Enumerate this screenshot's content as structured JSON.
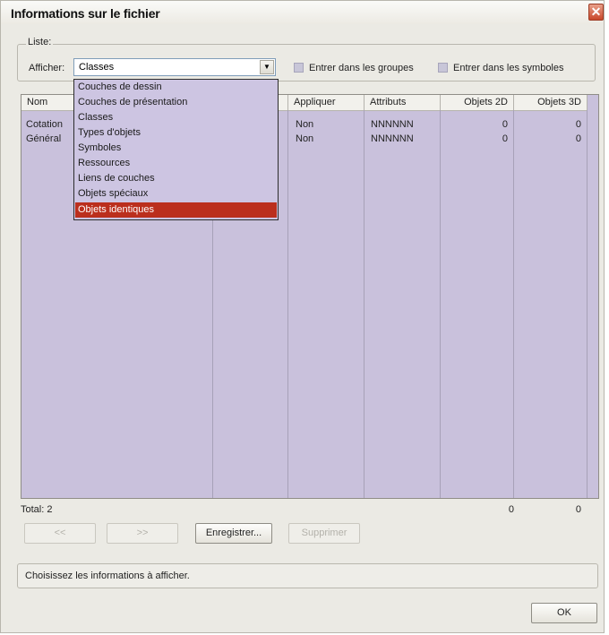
{
  "window": {
    "title": "Informations sur le fichier",
    "close_glyph": "✕"
  },
  "liste": {
    "group_label": "Liste:",
    "afficher_label": "Afficher:",
    "selected": "Classes",
    "options": [
      "Couches de dessin",
      "Couches de présentation",
      "Classes",
      "Types d'objets",
      "Symboles",
      "Ressources",
      "Liens de couches",
      "Objets spéciaux",
      "Objets identiques"
    ],
    "highlighted_option": "Objets identiques",
    "checkbox_groups_label": "Entrer dans les groupes",
    "checkbox_symbols_label": "Entrer dans les symboles"
  },
  "table": {
    "columns": [
      "Nom",
      "",
      "Appliquer",
      "Attributs",
      "Objets 2D",
      "Objets 3D"
    ],
    "rows": [
      [
        "Cotation",
        "",
        "Non",
        "NNNNNN",
        "0",
        "0"
      ],
      [
        "Général",
        "",
        "Non",
        "NNNNNN",
        "0",
        "0"
      ]
    ]
  },
  "totals": {
    "label": "Total: 2",
    "objets_2d": "0",
    "objets_3d": "0"
  },
  "buttons": {
    "prev": "<<",
    "next": ">>",
    "save": "Enregistrer...",
    "delete": "Supprimer",
    "ok": "OK"
  },
  "status": {
    "text": "Choisissez les informations à afficher."
  },
  "colors": {
    "list_background": "#c9c1dc",
    "selection": "#bb2f1d",
    "dialog_background": "#ebeae4"
  },
  "icons": {
    "dropdown_arrow": "▼"
  }
}
